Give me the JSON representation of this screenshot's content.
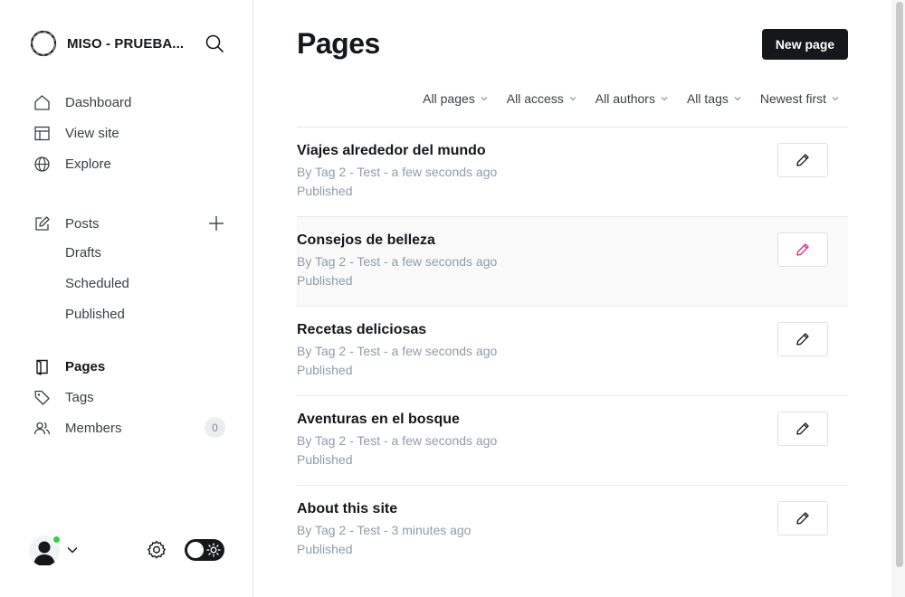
{
  "sidebar": {
    "site_name": "MISO - PRUEBA...",
    "nav": [
      {
        "label": "Dashboard",
        "icon": "home-icon"
      },
      {
        "label": "View site",
        "icon": "layout-icon"
      },
      {
        "label": "Explore",
        "icon": "globe-icon"
      }
    ],
    "posts": {
      "label": "Posts",
      "icon": "edit-icon",
      "sub_items": [
        "Drafts",
        "Scheduled",
        "Published"
      ]
    },
    "pages_label": "Pages",
    "tags_label": "Tags",
    "members_label": "Members",
    "members_count": "0"
  },
  "main": {
    "title": "Pages",
    "new_button": "New page",
    "filters": [
      "All pages",
      "All access",
      "All authors",
      "All tags",
      "Newest first"
    ],
    "rows": [
      {
        "title": "Viajes alrededor del mundo",
        "meta": "By Tag 2 - Test - a few seconds ago",
        "status": "Published"
      },
      {
        "title": "Consejos de belleza",
        "meta": "By Tag 2 - Test - a few seconds ago",
        "status": "Published"
      },
      {
        "title": "Recetas deliciosas",
        "meta": "By Tag 2 - Test - a few seconds ago",
        "status": "Published"
      },
      {
        "title": "Aventuras en el bosque",
        "meta": "By Tag 2 - Test - a few seconds ago",
        "status": "Published"
      },
      {
        "title": "About this site",
        "meta": "By Tag 2 - Test - 3 minutes ago",
        "status": "Published"
      }
    ]
  },
  "colors": {
    "accent": "#15171a",
    "online": "#30cf43",
    "hover_pencil": "#e0267a",
    "muted_text": "#8e9cac"
  }
}
